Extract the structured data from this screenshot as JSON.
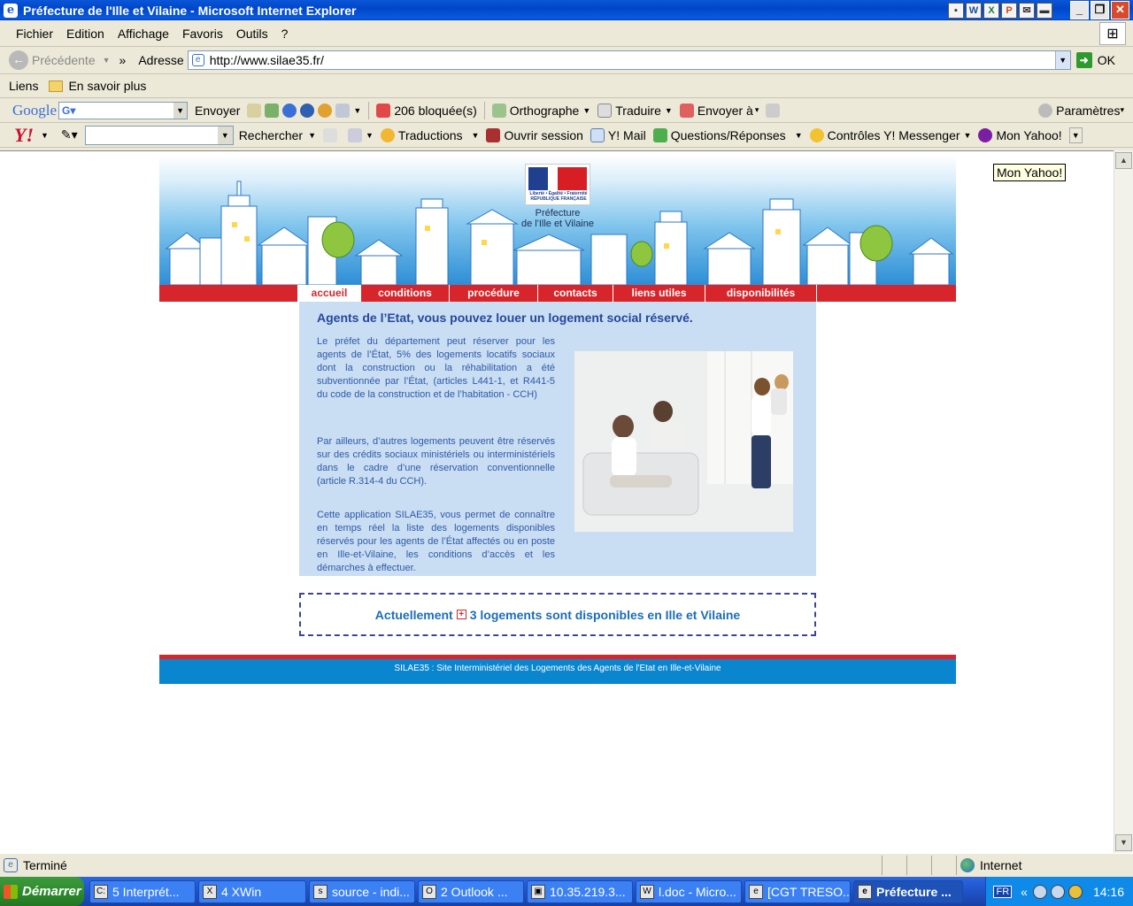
{
  "window": {
    "title": "Préfecture de l'Ille et Vilaine - Microsoft Internet Explorer",
    "app_icon": "e"
  },
  "menubar": {
    "items": [
      "Fichier",
      "Edition",
      "Affichage",
      "Favoris",
      "Outils",
      "?"
    ]
  },
  "navbar": {
    "back_label": "Précédente",
    "address_label": "Adresse",
    "url": "http://www.silae35.fr/",
    "go_label": "OK"
  },
  "linksbar": {
    "label": "Liens",
    "item": "En savoir plus"
  },
  "google_toolbar": {
    "logo": "Google",
    "send_label": "Envoyer",
    "blocked_label": "206 bloquée(s)",
    "spell_label": "Orthographe",
    "translate_label": "Traduire",
    "send_to_label": "Envoyer à",
    "settings_label": "Paramètres"
  },
  "yahoo_toolbar": {
    "logo": "Y!",
    "search_label": "Rechercher",
    "translations_label": "Traductions",
    "open_session_label": "Ouvrir session",
    "mail_label": "Y! Mail",
    "qa_label": "Questions/Réponses",
    "messenger_label": "Contrôles Y! Messenger",
    "my_yahoo_label": "Mon Yahoo!"
  },
  "tooltip": "Mon Yahoo!",
  "site": {
    "logo_text": "Liberté • Égalité • Fraternité RÉPUBLIQUE FRANÇAISE",
    "prefecture_line1": "Préfecture",
    "prefecture_line2": "de l'Ille et Vilaine",
    "nav": [
      "accueil",
      "conditions",
      "procédure",
      "contacts",
      "liens utiles",
      "disponibilités"
    ],
    "active_nav": "accueil",
    "headline": "Agents de l’Etat, vous pouvez louer un logement social réservé.",
    "paragraphs": [
      "Le préfet du département peut réserver pour les agents de l’État, 5% des logements locatifs sociaux dont la construction ou la réhabilitation a été subventionnée par l’État, (articles L441-1, et R441-5 du code de la construction et de l’habitation - CCH)",
      "Par ailleurs, d’autres logements peuvent être réservés sur des crédits sociaux ministériels ou interministériels dans le cadre d’une réservation conventionnelle (article R.314-4 du CCH).",
      "Cette application SILAE35, vous permet de connaître en temps réel la liste des logements disponibles réservés pour les agents de l’État affectés ou en poste en Ille-et-Vilaine, les conditions d’accès et les démarches à effectuer."
    ],
    "availability_prefix": "Actuellement",
    "availability_text": "3 logements sont disponibles en Ille et Vilaine",
    "footer": "SILAE35 : Site Interministériel des Logements des Agents de l'Etat en Ille-et-Vilaine"
  },
  "statusbar": {
    "status": "Terminé",
    "zone": "Internet"
  },
  "taskbar": {
    "start_label": "Démarrer",
    "tasks": [
      "5 Interprét...",
      "4 XWin",
      "source - indi...",
      "2 Outlook ...",
      "10.35.219.3...",
      "l.doc - Micro...",
      "[CGT TRESO...",
      "Préfecture ..."
    ],
    "active_task": "Préfecture ...",
    "lang": "FR",
    "clock": "14:16"
  }
}
